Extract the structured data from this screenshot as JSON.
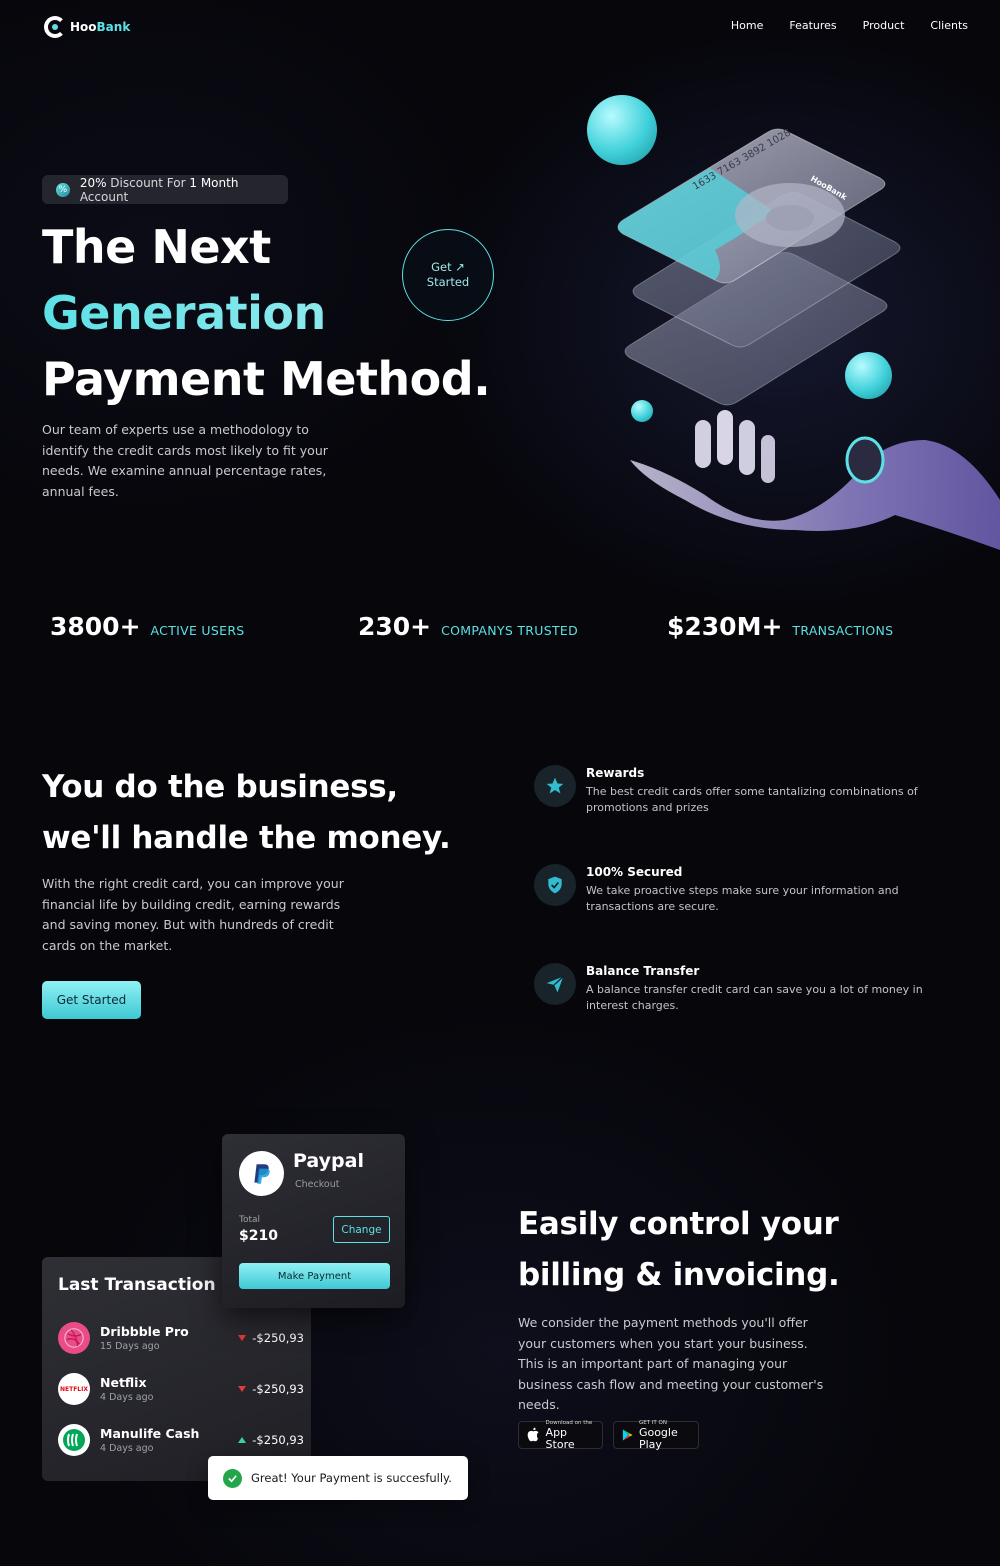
{
  "brand": {
    "name_part1": "Hoo",
    "name_part2": "Bank",
    "accent": "#5ce1e6"
  },
  "nav": {
    "items": [
      "Home",
      "Features",
      "Product",
      "Clients"
    ]
  },
  "hero": {
    "discount_prefix": "20%",
    "discount_middle": " Discount For ",
    "discount_strong": "1",
    "discount_suffix": " Month",
    "discount_end": " Account",
    "title_line1": "The Next",
    "title_line2": "Generation",
    "title_line3": "Payment Method.",
    "description": "Our team of experts use a methodology to identify the credit cards most likely to fit your needs. We examine annual percentage rates, annual fees.",
    "cta_line1": "Get",
    "cta_line2": "Started",
    "card_number": "1633 7163 3892 1028",
    "card_brand": "HooBank"
  },
  "stats": [
    {
      "value": "3800+",
      "label": "ACTIVE USERS"
    },
    {
      "value": "230+",
      "label": "COMPANYS TRUSTED"
    },
    {
      "value": "$230M+",
      "label": "TRANSACTIONS"
    }
  ],
  "business": {
    "title_line1": "You do the business,",
    "title_line2": "we'll handle the money.",
    "description": "With the right credit card, you can improve your financial life by building credit, earning rewards and saving money. But with hundreds of credit cards on the market.",
    "button_label": "Get Started",
    "features": [
      {
        "title": "Rewards",
        "description": "The best credit cards offer some tantalizing combinations of promotions and prizes",
        "icon": "star-icon"
      },
      {
        "title": "100% Secured",
        "description": "We take proactive steps make sure your information and transactions are secure.",
        "icon": "shield-icon"
      },
      {
        "title": "Balance Transfer",
        "description": "A balance transfer credit card can save you a lot of money in interest charges.",
        "icon": "send-icon"
      }
    ]
  },
  "paypal": {
    "title": "Paypal",
    "subtitle": "Checkout",
    "total_label": "Total",
    "total_value": "$210",
    "change_label": "Change",
    "pay_label": "Make Payment"
  },
  "transactions": {
    "title": "Last Transaction",
    "items": [
      {
        "name": "Dribbble Pro",
        "date": "15 Days ago",
        "amount": "-$250,93",
        "direction": "down",
        "logo_text": ""
      },
      {
        "name": "Netflix",
        "date": "4 Days ago",
        "amount": "-$250,93",
        "direction": "down",
        "logo_text": "NETFLIX"
      },
      {
        "name": "Manulife Cash",
        "date": "4 Days ago",
        "amount": "-$250,93",
        "direction": "up",
        "logo_text": ""
      }
    ]
  },
  "toast": {
    "message": "Great! Your Payment is succesfully."
  },
  "billing": {
    "title_line1": "Easily control your",
    "title_line2": "billing & invoicing.",
    "description": "We consider the payment methods you'll offer your customers when you start your business. This is an important part of managing your business cash flow and meeting your customer's needs.",
    "appstore_small": "Download on the",
    "appstore_big": "App Store",
    "googleplay_small": "GET IT ON",
    "googleplay_big": "Google Play"
  }
}
